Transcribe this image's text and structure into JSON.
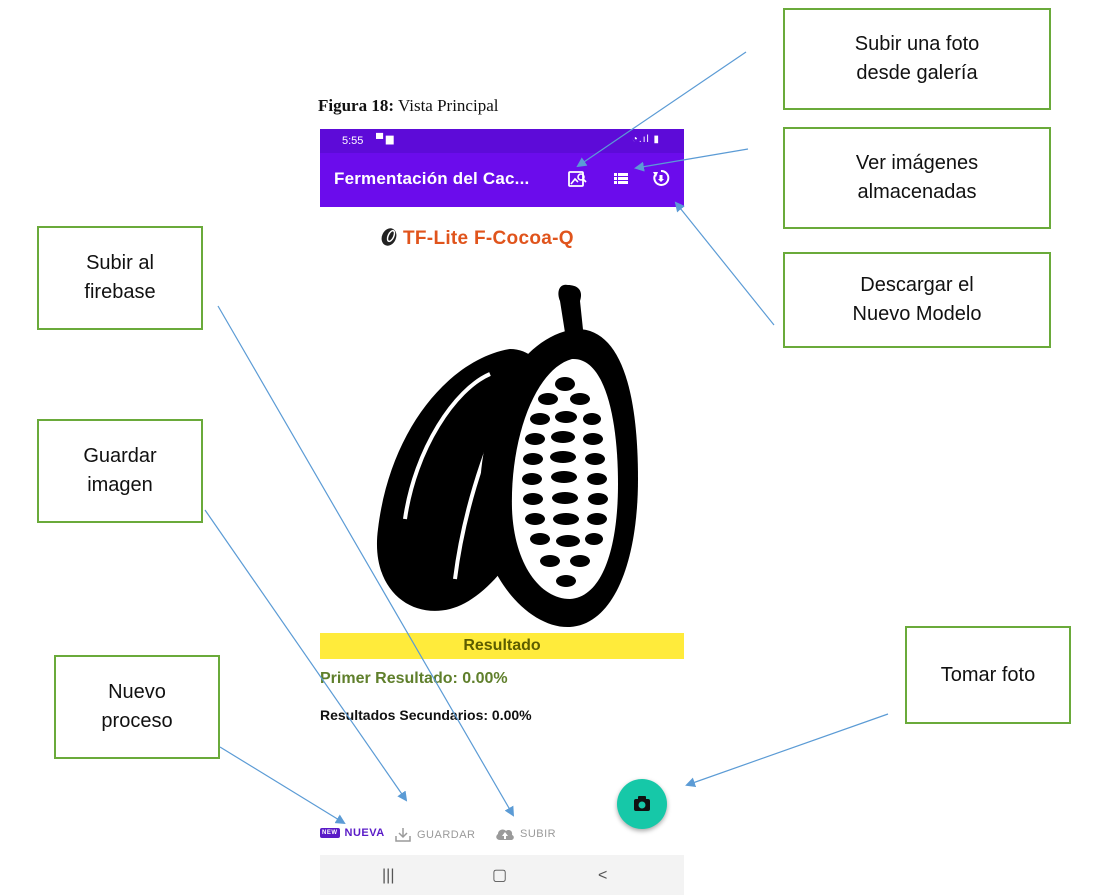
{
  "figure": {
    "label": "Figura 18:",
    "text": "Vista Principal"
  },
  "status_bar": {
    "time": "5:55"
  },
  "app_bar": {
    "title": "Fermentación del Cac..."
  },
  "brand": {
    "text": "TF-Lite F-Cocoa-Q"
  },
  "result": {
    "header": "Resultado",
    "primary": "Primer Resultado: 0.00%",
    "secondary": "Resultados Secundarios: 0.00%"
  },
  "bottom_nav": {
    "new_badge": "NEW",
    "new_label": "NUEVA",
    "save_label": "GUARDAR",
    "upload_label": "SUBIR"
  },
  "callouts": {
    "gallery": {
      "line1": "Subir una foto",
      "line2": "desde galería"
    },
    "stored": {
      "line1": "Ver imágenes",
      "line2": "almacenadas"
    },
    "download": {
      "line1": "Descargar el",
      "line2": "Nuevo Modelo"
    },
    "firebase": {
      "line1": "Subir al",
      "line2": "firebase"
    },
    "save": {
      "line1": "Guardar",
      "line2": "imagen"
    },
    "new_process": {
      "line1": "Nuevo",
      "line2": "proceso"
    },
    "take_photo": {
      "line1": "Tomar foto"
    }
  },
  "icons": {
    "gallery": "image-search-icon",
    "list": "list-icon",
    "download": "sync-download-icon",
    "camera": "camera-icon",
    "save": "download-tray-icon",
    "upload": "cloud-upload-icon"
  },
  "colors": {
    "app_bar": "#6b0cec",
    "status_bar": "#5d0bd8",
    "result_bar": "#ffeb3b",
    "fab": "#16c8a8",
    "callout_border": "#6aaa3a",
    "arrow": "#5b9bd5"
  }
}
